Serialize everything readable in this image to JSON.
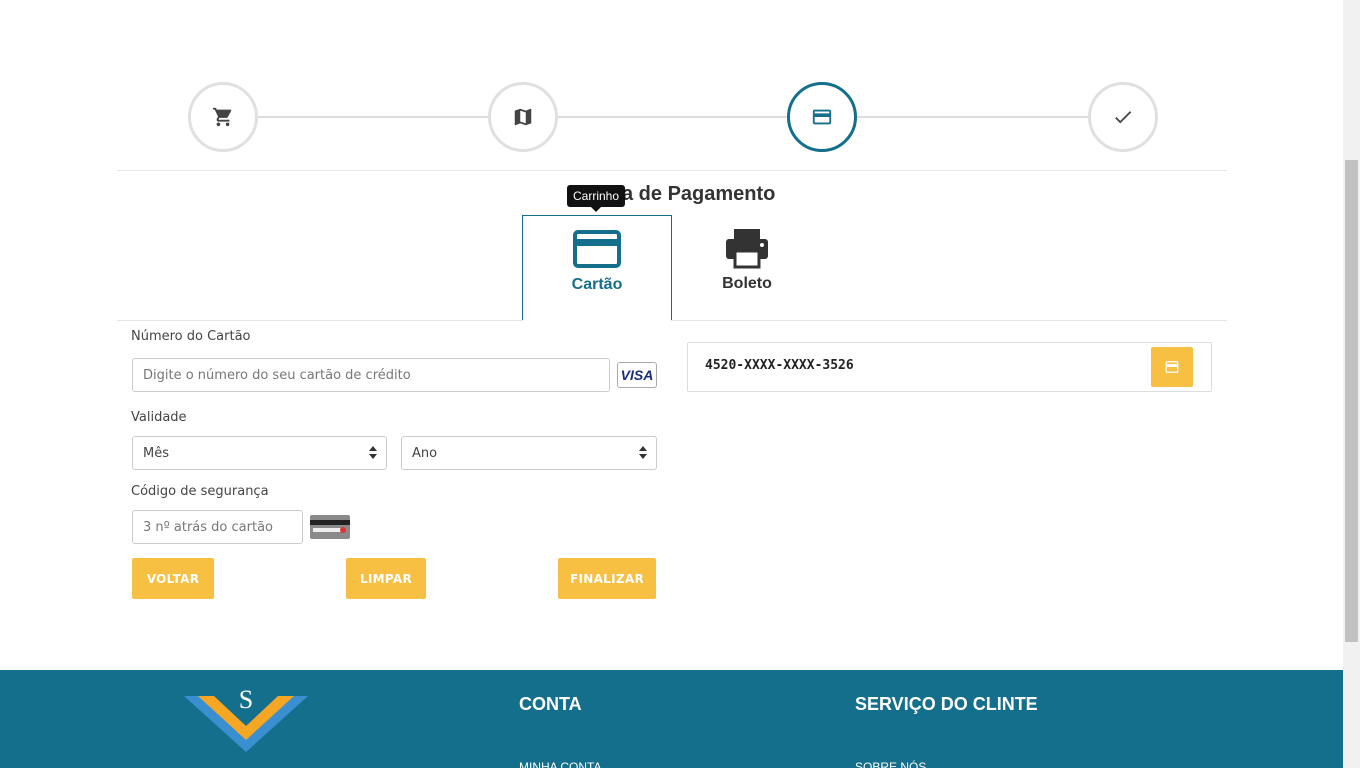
{
  "stepper": {
    "steps": [
      {
        "icon": "cart-icon",
        "state": "done"
      },
      {
        "icon": "map-icon",
        "state": "done"
      },
      {
        "icon": "credit-card-icon",
        "state": "active"
      },
      {
        "icon": "check-icon",
        "state": "pending"
      }
    ],
    "tooltip": "Carrinho"
  },
  "section": {
    "title": "Forma de Pagamento"
  },
  "payment_tabs": [
    {
      "label": "Cartão",
      "icon": "credit-card-icon",
      "active": true
    },
    {
      "label": "Boleto",
      "icon": "printer-icon",
      "active": false
    }
  ],
  "form": {
    "card_number_label": "Número do Cartão",
    "card_number_placeholder": "Digite o número do seu cartão de crédito",
    "card_brand": "VISA",
    "validity_label": "Validade",
    "month_selected": "Mês",
    "year_selected": "Ano",
    "security_label": "Código de segurança",
    "security_placeholder": "3 nº atrás do cartão"
  },
  "buttons": {
    "back": "VOLTAR",
    "clear": "LIMPAR",
    "finish": "FINALIZAR"
  },
  "card_preview": {
    "number": "4520-XXXX-XXXX-3526"
  },
  "footer": {
    "logo_letter": "S",
    "columns": [
      {
        "heading": "CONTA",
        "first_link": "MINHA CONTA"
      },
      {
        "heading": "SERVIÇO DO CLINTE",
        "first_link": "SOBRE NÓS"
      }
    ]
  },
  "colors": {
    "primary": "#146f8c",
    "accent": "#f7c043",
    "step_border": "#e0e0e0"
  }
}
